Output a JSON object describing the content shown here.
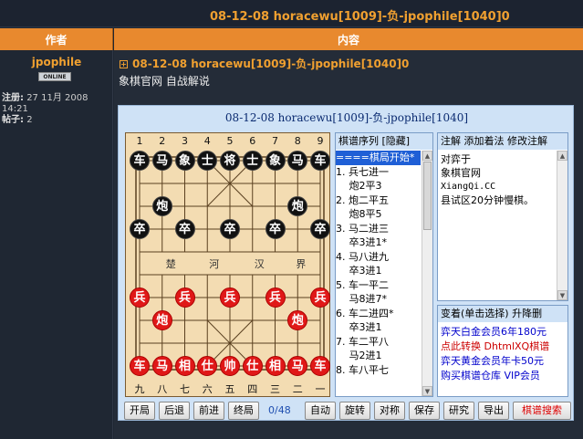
{
  "topbar": {
    "title": "08-12-08 horacewu[1009]-负-jpophile[1040]0"
  },
  "header": {
    "author": "作者",
    "content": "内容"
  },
  "user": {
    "name": "jpophile",
    "badge": "ONLINE",
    "reg_label": "注册:",
    "reg_value": "27 11月 2008 14:21",
    "posts_label": "帖子:",
    "posts_value": "2"
  },
  "post": {
    "title": "08-12-08 horacewu[1009]-负-jpophile[1040]0",
    "subtitle": "象棋官网 自战解说"
  },
  "viewer": {
    "title": "08-12-08 horacewu[1009]-负-jpophile[1040]",
    "top_numbers": [
      "1",
      "2",
      "3",
      "4",
      "5",
      "6",
      "7",
      "8",
      "9"
    ],
    "bottom_numbers": [
      "九",
      "八",
      "七",
      "六",
      "五",
      "四",
      "三",
      "二",
      "一"
    ],
    "river": [
      "楚",
      "河",
      "汉",
      "界"
    ],
    "pieces": [
      {
        "c": "b",
        "t": "车",
        "col": 0,
        "row": 0
      },
      {
        "c": "b",
        "t": "马",
        "col": 1,
        "row": 0
      },
      {
        "c": "b",
        "t": "象",
        "col": 2,
        "row": 0
      },
      {
        "c": "b",
        "t": "士",
        "col": 3,
        "row": 0
      },
      {
        "c": "b",
        "t": "将",
        "col": 4,
        "row": 0
      },
      {
        "c": "b",
        "t": "士",
        "col": 5,
        "row": 0
      },
      {
        "c": "b",
        "t": "象",
        "col": 6,
        "row": 0
      },
      {
        "c": "b",
        "t": "马",
        "col": 7,
        "row": 0
      },
      {
        "c": "b",
        "t": "车",
        "col": 8,
        "row": 0
      },
      {
        "c": "b",
        "t": "炮",
        "col": 1,
        "row": 2
      },
      {
        "c": "b",
        "t": "炮",
        "col": 7,
        "row": 2
      },
      {
        "c": "b",
        "t": "卒",
        "col": 0,
        "row": 3
      },
      {
        "c": "b",
        "t": "卒",
        "col": 2,
        "row": 3
      },
      {
        "c": "b",
        "t": "卒",
        "col": 4,
        "row": 3
      },
      {
        "c": "b",
        "t": "卒",
        "col": 6,
        "row": 3
      },
      {
        "c": "b",
        "t": "卒",
        "col": 8,
        "row": 3
      },
      {
        "c": "r",
        "t": "兵",
        "col": 0,
        "row": 6
      },
      {
        "c": "r",
        "t": "兵",
        "col": 2,
        "row": 6
      },
      {
        "c": "r",
        "t": "兵",
        "col": 4,
        "row": 6
      },
      {
        "c": "r",
        "t": "兵",
        "col": 6,
        "row": 6
      },
      {
        "c": "r",
        "t": "兵",
        "col": 8,
        "row": 6
      },
      {
        "c": "r",
        "t": "炮",
        "col": 1,
        "row": 7
      },
      {
        "c": "r",
        "t": "炮",
        "col": 7,
        "row": 7
      },
      {
        "c": "r",
        "t": "车",
        "col": 0,
        "row": 9
      },
      {
        "c": "r",
        "t": "马",
        "col": 1,
        "row": 9
      },
      {
        "c": "r",
        "t": "相",
        "col": 2,
        "row": 9
      },
      {
        "c": "r",
        "t": "仕",
        "col": 3,
        "row": 9
      },
      {
        "c": "r",
        "t": "帅",
        "col": 4,
        "row": 9
      },
      {
        "c": "r",
        "t": "仕",
        "col": 5,
        "row": 9
      },
      {
        "c": "r",
        "t": "相",
        "col": 6,
        "row": 9
      },
      {
        "c": "r",
        "t": "马",
        "col": 7,
        "row": 9
      },
      {
        "c": "r",
        "t": "车",
        "col": 8,
        "row": 9
      }
    ],
    "moves_header": "棋谱序列  [隐藏]",
    "moves": [
      "====棋局开始*",
      "1. 兵七进一",
      "　 炮2平3",
      "2. 炮二平五",
      "　 炮8平5",
      "3. 马二进三",
      "　 卒3进1*",
      "4. 马八进九",
      "　 卒3进1",
      "5. 车一平二",
      "　 马8进7*",
      "6. 车二进四*",
      "　 卒3进1",
      "7. 车二平八",
      "　 马2进1",
      "8. 车八平七"
    ],
    "comment_header": "注解 添加着法 修改注解",
    "comment_lines": [
      "对弈于",
      "象棋官网",
      "XiangQi.CC",
      "县试区20分钟慢棋。"
    ],
    "variation_header": "变着(单击选择) 升降删",
    "ads": [
      {
        "text": "弈天白金会员6年180元",
        "color": "#0000cc"
      },
      {
        "text": "点此转换 DhtmlXQ棋谱",
        "color": "#cc0000"
      },
      {
        "text": "弈天黄金会员年卡50元",
        "color": "#0000cc"
      },
      {
        "text": "购买棋谱仓库 VIP会员",
        "color": "#0000cc"
      }
    ],
    "buttons": {
      "start": "开局",
      "prev": "后退",
      "next": "前进",
      "end": "终局",
      "counter": "0/48",
      "auto": "自动",
      "rotate": "旋转",
      "mirror": "对称",
      "save": "保存",
      "study": "研究",
      "export": "导出",
      "search": "棋谱搜索"
    }
  }
}
